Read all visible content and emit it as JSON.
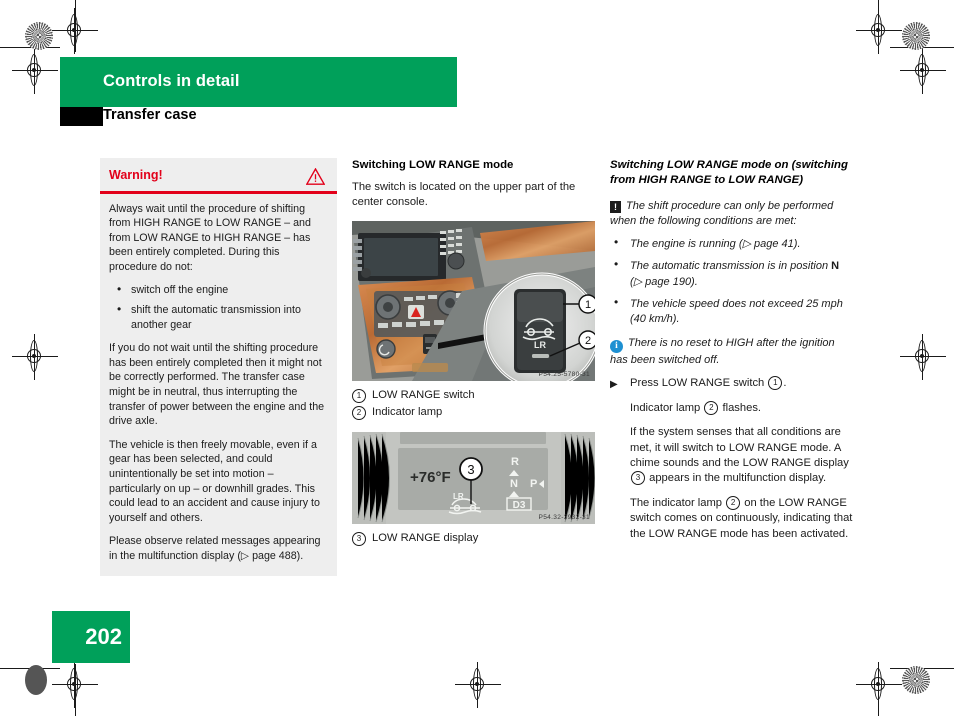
{
  "header": {
    "chapter": "Controls in detail",
    "section": "Transfer case"
  },
  "page_number": "202",
  "warning": {
    "title": "Warning!",
    "icon": "warning-triangle-icon",
    "accent_color": "#E2001A",
    "paragraph1": "Always wait until the procedure of shifting from HIGH RANGE to LOW RANGE – and from LOW RANGE to HIGH RANGE – has been entirely completed. During this procedure do not:",
    "bullets": [
      "switch off the engine",
      "shift the automatic transmission into another gear"
    ],
    "paragraph2": "If you do not wait until the shifting procedure has been entirely completed then it might not be correctly performed. The transfer case might be in neutral, thus interrupting the transfer of power between the engine and the drive axle.",
    "paragraph3": "The vehicle is then freely movable, even if a gear has been selected, and could unintentionally be set into motion – particularly on up – or downhill grades. This could lead to an accident and cause injury to yourself and others.",
    "paragraph4": "Please observe related messages appearing in the multifunction display (▷ page 488)."
  },
  "middle": {
    "heading": "Switching LOW RANGE mode",
    "intro": "The switch is located on the upper part of the center console.",
    "figure1": {
      "code": "P54.25-5780-31",
      "switch_label": "LR"
    },
    "legend1": [
      {
        "num": "1",
        "label": "LOW RANGE switch"
      },
      {
        "num": "2",
        "label": "Indicator lamp"
      }
    ],
    "figure2": {
      "code": "P54.32-3932-31",
      "temperature": "+76°F",
      "range_label": "LR",
      "gears": [
        "R",
        "N",
        "P"
      ],
      "gear_selected": "D3"
    },
    "legend2": [
      {
        "num": "3",
        "label": "LOW RANGE display"
      }
    ]
  },
  "right": {
    "heading": "Switching LOW RANGE mode on (switching from HIGH RANGE to LOW RANGE)",
    "note_icon": "exclamation-box-icon",
    "note_intro": "The shift procedure can only be performed when the following conditions are met:",
    "conditions": [
      "The engine is running (▷ page 41).",
      "The automatic transmission is in position N (▷ page 190).",
      "The vehicle speed does not exceed 25 mph (40 km/h)."
    ],
    "condition2_bold": "N",
    "info_icon": "info-circle-icon",
    "info_color": "#1E90D2",
    "info_text": "There is no reset to HIGH after the ignition has been switched off.",
    "step_arrow": "▶",
    "step_text_pre": "Press LOW RANGE switch ",
    "step_num": "1",
    "step_text_post": ".",
    "result1_pre": "Indicator lamp ",
    "result1_num": "2",
    "result1_post": " flashes.",
    "result2_pre": "If the system senses that all conditions are met, it will switch to LOW RANGE mode. A chime sounds and the LOW RANGE display ",
    "result2_num": "3",
    "result2_post": " appears in the multifunction display.",
    "result3_pre": "The indicator lamp ",
    "result3_num": "2",
    "result3_post": " on the LOW RANGE switch comes on continuously, indicating that the LOW RANGE mode has been activated."
  }
}
